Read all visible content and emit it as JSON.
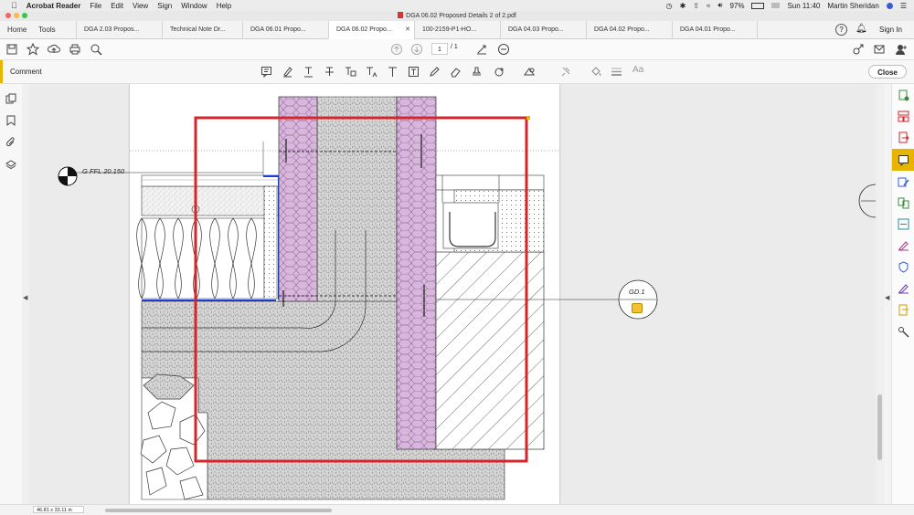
{
  "menubar": {
    "app_name": "Acrobat Reader",
    "items": [
      "File",
      "Edit",
      "View",
      "Sign",
      "Window",
      "Help"
    ],
    "battery": "97%",
    "clock": "Sun 11:40",
    "user": "Martin Sheridan"
  },
  "window": {
    "title": "DGA 06.02 Proposed Details 2 of 2.pdf"
  },
  "nav": {
    "home": "Home",
    "tools": "Tools"
  },
  "tabs": [
    {
      "label": "DGA 2.03 Propos..."
    },
    {
      "label": "Technical Note Dr..."
    },
    {
      "label": "DGA 06.01 Propo..."
    },
    {
      "label": "DGA 06.02 Propo...",
      "active": true
    },
    {
      "label": "100-2159-P1-HO..."
    },
    {
      "label": "DGA 04.03 Propo..."
    },
    {
      "label": "DGA 04.02 Propo..."
    },
    {
      "label": "DGA 04.01 Propo..."
    }
  ],
  "toolbar": {
    "page_current": "1",
    "page_total": "/ 1",
    "sign_in": "Sign In"
  },
  "comment_bar": {
    "label": "Comment",
    "close_label": "Close",
    "font_tool": "Aa"
  },
  "drawing": {
    "level_label": "G FFL 20.150",
    "callout_label": "GD.1"
  },
  "status": {
    "page_size": "46.81 x 33.11 in"
  },
  "colors": {
    "accent_yellow": "#e7b500",
    "markup_red": "#d6262d",
    "insulation_purple": "#d8b7dc",
    "membrane_blue": "#1a3fd6",
    "concrete_grey": "#c8c8c8"
  }
}
